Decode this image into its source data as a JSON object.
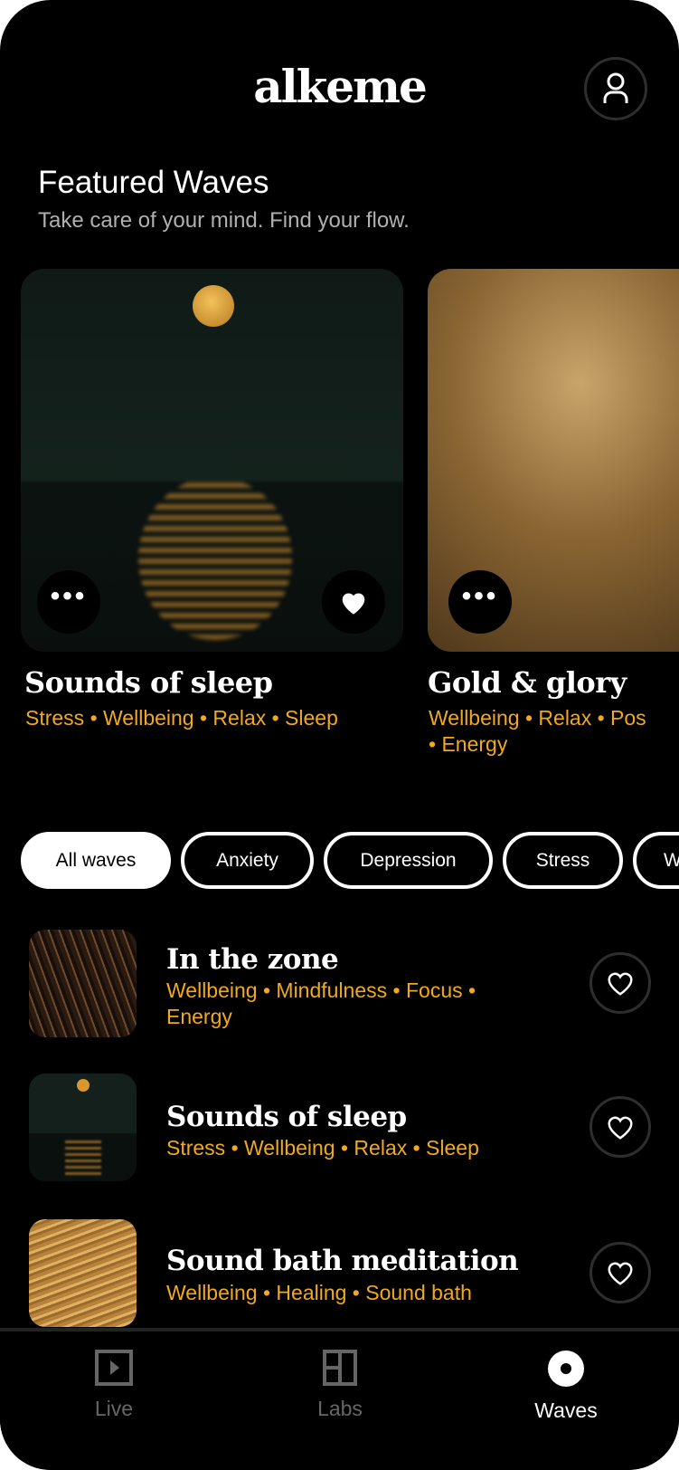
{
  "header": {
    "logo": "alkeme",
    "profile_icon": "user-icon"
  },
  "featured": {
    "title": "Featured Waves",
    "subtitle": "Take care of your mind. Find your flow.",
    "cards": [
      {
        "title": "Sounds of sleep",
        "tags": "Stress • Wellbeing • Relax • Sleep",
        "favorited": true
      },
      {
        "title": "Gold & glory",
        "tags": "Wellbeing • Relax • Pos",
        "tags_line2": "• Energy"
      }
    ]
  },
  "filters": [
    {
      "label": "All waves",
      "selected": true
    },
    {
      "label": "Anxiety"
    },
    {
      "label": "Depression"
    },
    {
      "label": "Stress"
    },
    {
      "label": "W"
    }
  ],
  "waves": [
    {
      "title": "In the zone",
      "tags": "Wellbeing • Mindfulness • Focus • Energy"
    },
    {
      "title": "Sounds of sleep",
      "tags": "Stress • Wellbeing • Relax • Sleep"
    },
    {
      "title": "Sound bath meditation",
      "tags": "Wellbeing • Healing • Sound bath"
    }
  ],
  "nav": [
    {
      "label": "Live",
      "icon": "play-square-icon"
    },
    {
      "label": "Labs",
      "icon": "layout-icon"
    },
    {
      "label": "Waves",
      "icon": "disc-icon",
      "active": true
    }
  ],
  "colors": {
    "accent": "#f0a920",
    "background": "#000000"
  }
}
